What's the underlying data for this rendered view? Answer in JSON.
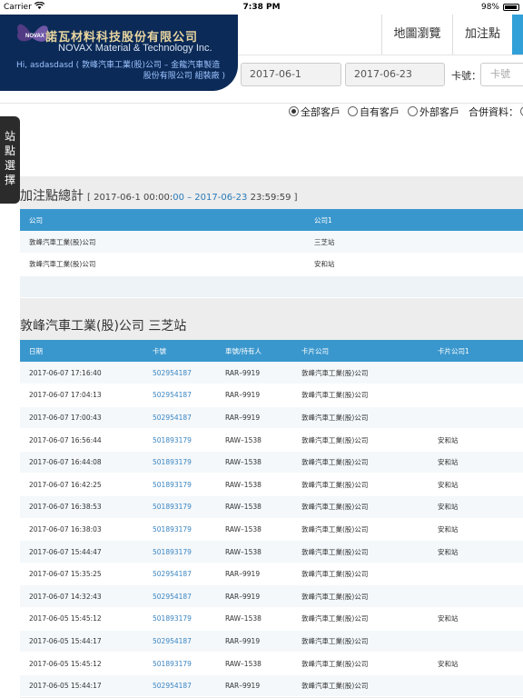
{
  "status_bar": {
    "carrier": "Carrier",
    "time": "7:38 PM",
    "battery": "98%"
  },
  "brand": {
    "cn_name": "諾瓦材料科技股份有限公司",
    "en_name": "NOVAX Material & Technology Inc.",
    "logo_text": "NOVAX",
    "greeting_line1": "Hi, asdasdasd ( 敦峰汽車工業(股)公司 – 金龍汽車製造",
    "greeting_line2": "股份有限公司 組裝廠 )"
  },
  "nav": {
    "map_label": "地圖瀏覽",
    "add_label": "加注點"
  },
  "filters": {
    "date_from": "2017-06-1",
    "date_to": "2017-06-23",
    "card_label": "卡號：",
    "card_placeholder": "卡號",
    "radios": [
      {
        "label": "全部客戶",
        "selected": true
      },
      {
        "label": "自有客戶",
        "selected": false
      },
      {
        "label": "外部客戶",
        "selected": false
      }
    ],
    "merge_label": "合併資料："
  },
  "side_tab": {
    "label": "站點選擇"
  },
  "summary": {
    "title": "加注點總計",
    "range_open": "[ 2017-06-1 00:00:",
    "range_blue": "00 – 2017-06-23",
    "range_close": " 23:59:59 ]",
    "headers": [
      "公司",
      "公司1"
    ],
    "rows": [
      [
        "敦峰汽車工業(股)公司",
        "三芝站"
      ],
      [
        "敦峰汽車工業(股)公司",
        "安和站"
      ]
    ]
  },
  "detail": {
    "title": "敦峰汽車工業(股)公司 三芝站",
    "headers": [
      "日期",
      "卡號",
      "車號/持有人",
      "卡片公司",
      "卡片公司1"
    ],
    "rows": [
      [
        "2017-06-07 17:16:40",
        "502954187",
        "RAR–9919",
        "敦峰汽車工業(股)公司",
        ""
      ],
      [
        "2017-06-07 17:04:13",
        "502954187",
        "RAR–9919",
        "敦峰汽車工業(股)公司",
        ""
      ],
      [
        "2017-06-07 17:00:43",
        "502954187",
        "RAR–9919",
        "敦峰汽車工業(股)公司",
        ""
      ],
      [
        "2017-06-07 16:56:44",
        "501893179",
        "RAW–1538",
        "敦峰汽車工業(股)公司",
        "安和站"
      ],
      [
        "2017-06-07 16:44:08",
        "501893179",
        "RAW–1538",
        "敦峰汽車工業(股)公司",
        "安和站"
      ],
      [
        "2017-06-07 16:42:25",
        "501893179",
        "RAW–1538",
        "敦峰汽車工業(股)公司",
        "安和站"
      ],
      [
        "2017-06-07 16:38:53",
        "501893179",
        "RAW–1538",
        "敦峰汽車工業(股)公司",
        "安和站"
      ],
      [
        "2017-06-07 16:38:03",
        "501893179",
        "RAW–1538",
        "敦峰汽車工業(股)公司",
        "安和站"
      ],
      [
        "2017-06-07 15:44:47",
        "501893179",
        "RAW–1538",
        "敦峰汽車工業(股)公司",
        "安和站"
      ],
      [
        "2017-06-07 15:35:25",
        "502954187",
        "RAR–9919",
        "敦峰汽車工業(股)公司",
        ""
      ],
      [
        "2017-06-07 14:32:43",
        "502954187",
        "RAR–9919",
        "敦峰汽車工業(股)公司",
        ""
      ],
      [
        "2017-06-05 15:45:12",
        "501893179",
        "RAW–1538",
        "敦峰汽車工業(股)公司",
        "安和站"
      ],
      [
        "2017-06-05 15:44:17",
        "502954187",
        "RAR–9919",
        "敦峰汽車工業(股)公司",
        ""
      ],
      [
        "2017-06-05 15:45:12",
        "501893179",
        "RAW–1538",
        "敦峰汽車工業(股)公司",
        "安和站"
      ],
      [
        "2017-06-05 15:44:17",
        "502954187",
        "RAR–9919",
        "敦峰汽車工業(股)公司",
        ""
      ]
    ]
  },
  "colors": {
    "brand_navy": "#0b2a57",
    "table_header": "#3a97cd",
    "link": "#3a84c0",
    "side_tab": "#2b2b2b"
  }
}
